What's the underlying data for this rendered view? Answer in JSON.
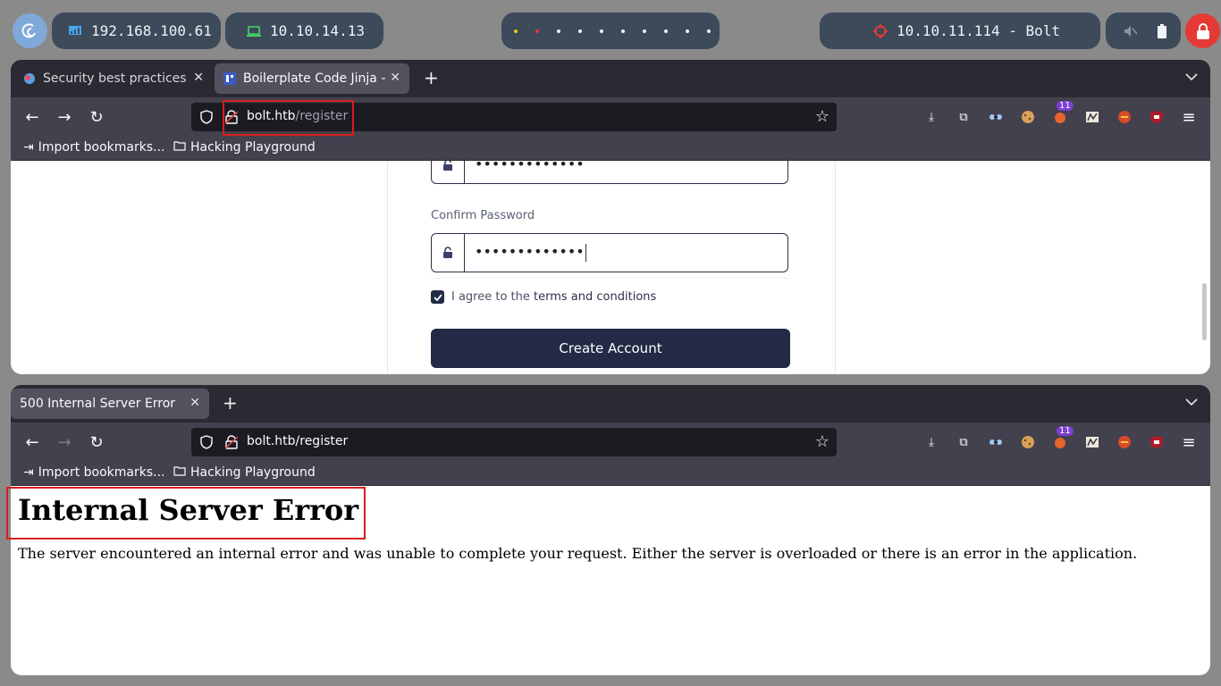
{
  "statusbar": {
    "ip_local": "192.168.100.61",
    "ip_vpn": "10.10.14.13",
    "target": "10.10.11.114 - Bolt"
  },
  "top_window": {
    "tabs": [
      {
        "title": "Security best practices |"
      },
      {
        "title": "Boilerplate Code Jinja - Si"
      }
    ],
    "url_host": "bolt.htb",
    "url_path": "/register",
    "extension_badge": "11",
    "bookmarks": [
      "Import bookmarks...",
      "Hacking Playground"
    ],
    "form": {
      "password_mask": "•••••••••••••",
      "confirm_label": "Confirm Password",
      "confirm_mask": "•••••••••••••",
      "agree_prefix": "I agree to the ",
      "agree_link": "terms and conditions",
      "submit_label": "Create Account"
    }
  },
  "bottom_window": {
    "tabs": [
      {
        "title": "500 Internal Server Error"
      }
    ],
    "url": "bolt.htb/register",
    "extension_badge": "11",
    "bookmarks": [
      "Import bookmarks...",
      "Hacking Playground"
    ],
    "error_title": "Internal Server Error",
    "error_message": "The server encountered an internal error and was unable to complete your request. Either the server is overloaded or there is an error in the application."
  },
  "colors": {
    "highlight": "#d81e1e",
    "button": "#222a45",
    "browser_chrome": "#2b2a33"
  }
}
